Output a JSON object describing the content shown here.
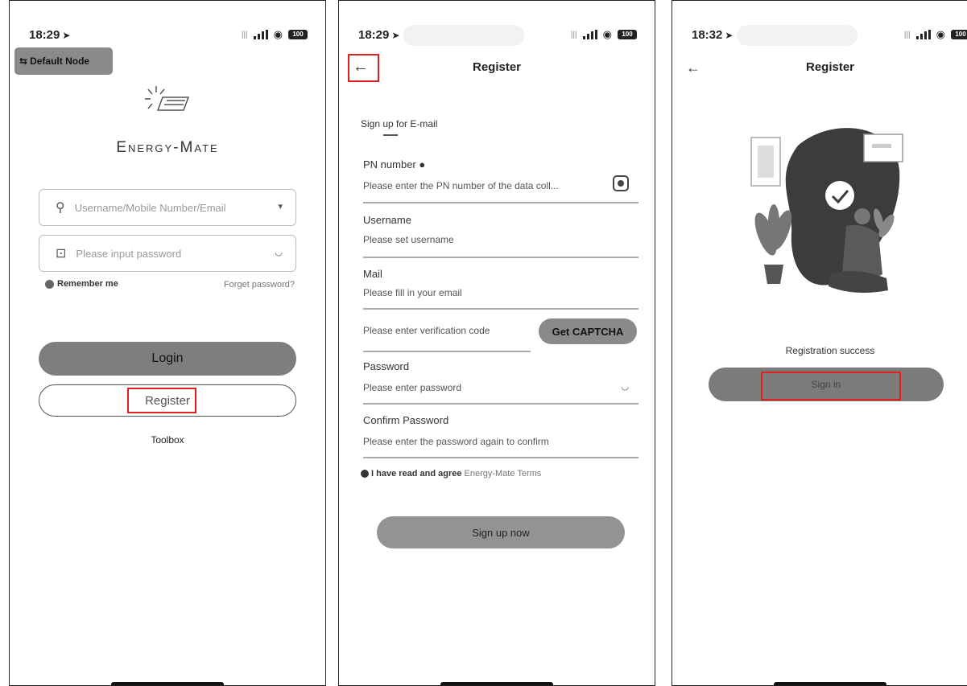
{
  "status_bars": [
    {
      "time": "18:29",
      "battery": "100"
    },
    {
      "time": "18:29",
      "battery": "100"
    },
    {
      "time": "18:32",
      "battery": "100"
    }
  ],
  "login_screen": {
    "node_button": "Default Node",
    "brand": "Energy-Mate",
    "username_placeholder": "Username/Mobile Number/Email",
    "password_placeholder": "Please input password",
    "remember_me": "Remember me",
    "forget_password": "Forget password?",
    "login_label": "Login",
    "register_label": "Register",
    "toolbox_label": "Toolbox"
  },
  "register_screen": {
    "title": "Register",
    "tab": "Sign up for E-mail",
    "pn_label": "PN number",
    "pn_placeholder": "Please enter the PN number of the data coll...",
    "username_label": "Username",
    "username_placeholder": "Please set username",
    "mail_label": "Mail",
    "mail_placeholder": "Please fill in your email",
    "code_placeholder": "Please enter verification code",
    "captcha_button": "Get CAPTCHA",
    "password_label": "Password",
    "password_placeholder": "Please enter password",
    "confirm_label": "Confirm Password",
    "confirm_placeholder": "Please enter the password again to confirm",
    "agree_text": "I have read and agree",
    "terms_link": "Energy-Mate Terms",
    "signup_button": "Sign up now"
  },
  "success_screen": {
    "title": "Register",
    "message": "Registration success",
    "signin_button": "Sign in"
  },
  "colors": {
    "highlight": "#e02020",
    "button_gray": "#7e7e7e"
  }
}
